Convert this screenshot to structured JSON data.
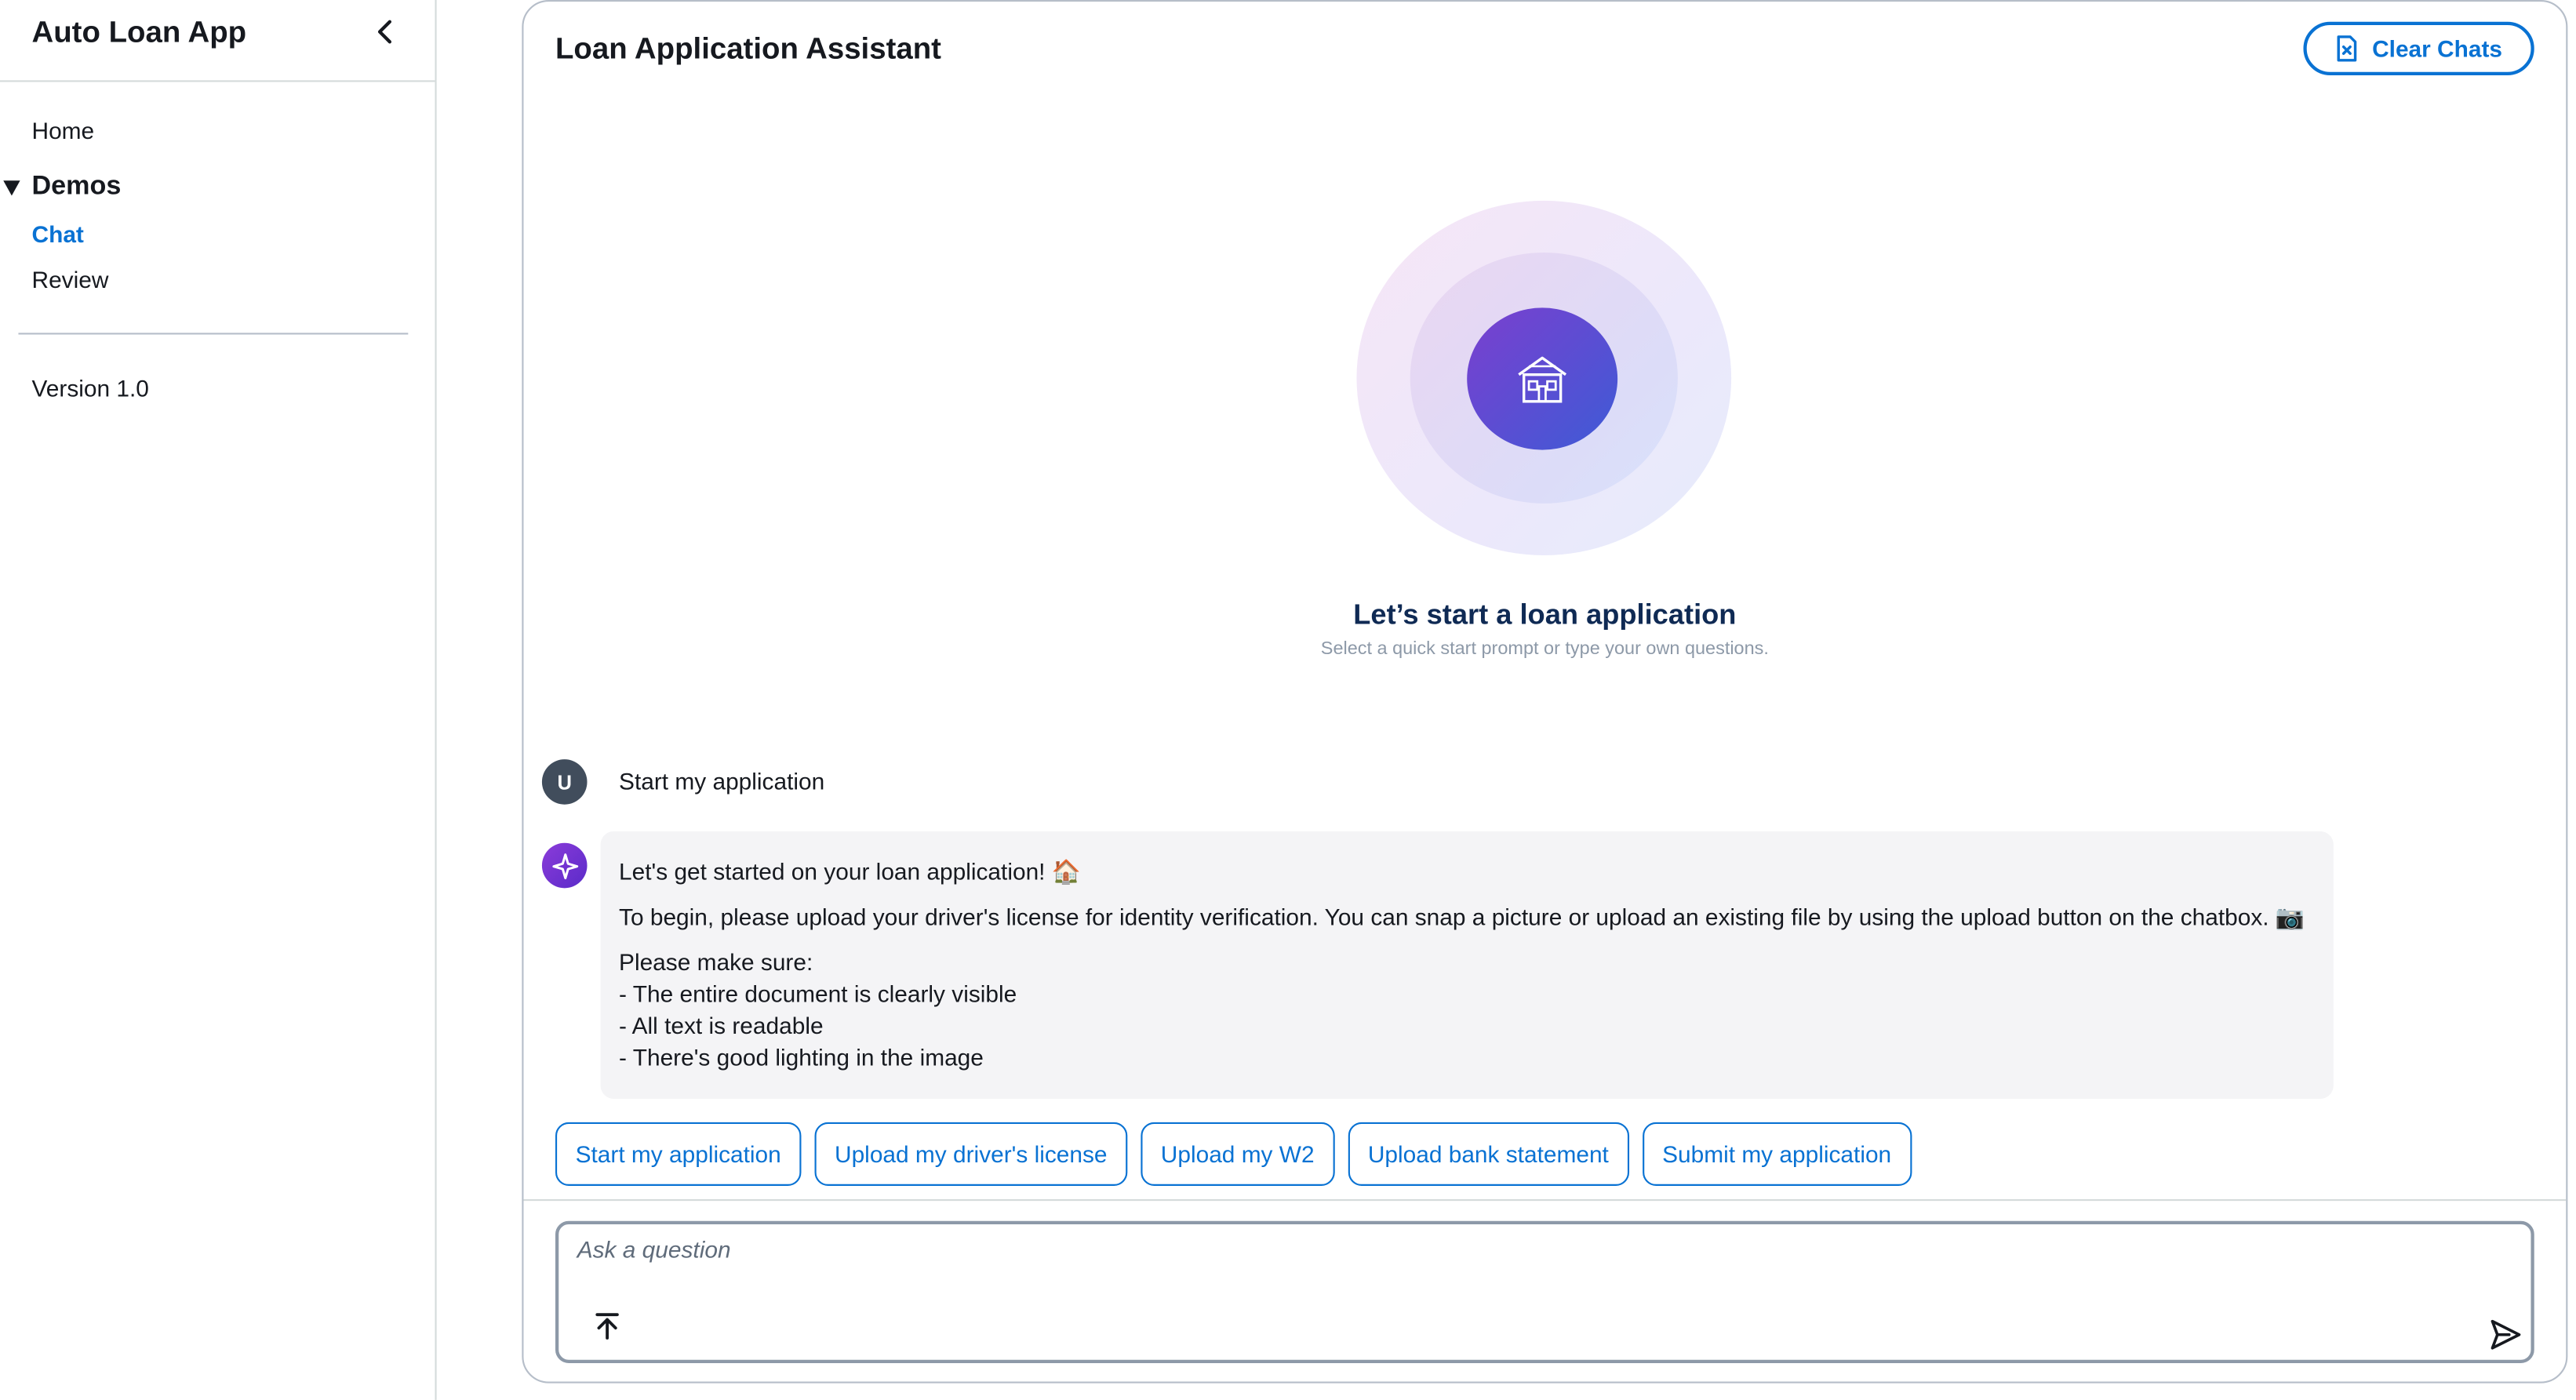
{
  "sidebar": {
    "app_title": "Auto Loan App",
    "nav": {
      "home": "Home",
      "group_label": "Demos",
      "chat": "Chat",
      "review": "Review"
    },
    "version": "Version 1.0"
  },
  "panel": {
    "title": "Loan Application Assistant",
    "clear_button": "Clear Chats"
  },
  "hero": {
    "icon": "house-icon",
    "title": "Let’s start a loan application",
    "subtitle": "Select a quick start prompt or type your own questions."
  },
  "messages": {
    "user": {
      "avatar": "U",
      "text": "Start my application"
    },
    "assistant": {
      "line1": "Let's get started on your loan application! 🏠",
      "line2": "To begin, please upload your driver's license for identity verification. You can snap a picture or upload an existing file by using the upload button on the chatbox. 📷",
      "line3": "Please make sure:",
      "line4": "- The entire document is clearly visible",
      "line5": "- All text is readable",
      "line6": "- There's good lighting in the image"
    }
  },
  "quick_prompts": [
    "Start my application",
    "Upload my driver's license",
    "Upload my W2",
    "Upload bank statement",
    "Submit my application"
  ],
  "input": {
    "placeholder": "Ask a question"
  },
  "colors": {
    "accent": "#0972d3",
    "hero_title": "#0f2a54",
    "ai_bubble": "#f4f4f6"
  }
}
